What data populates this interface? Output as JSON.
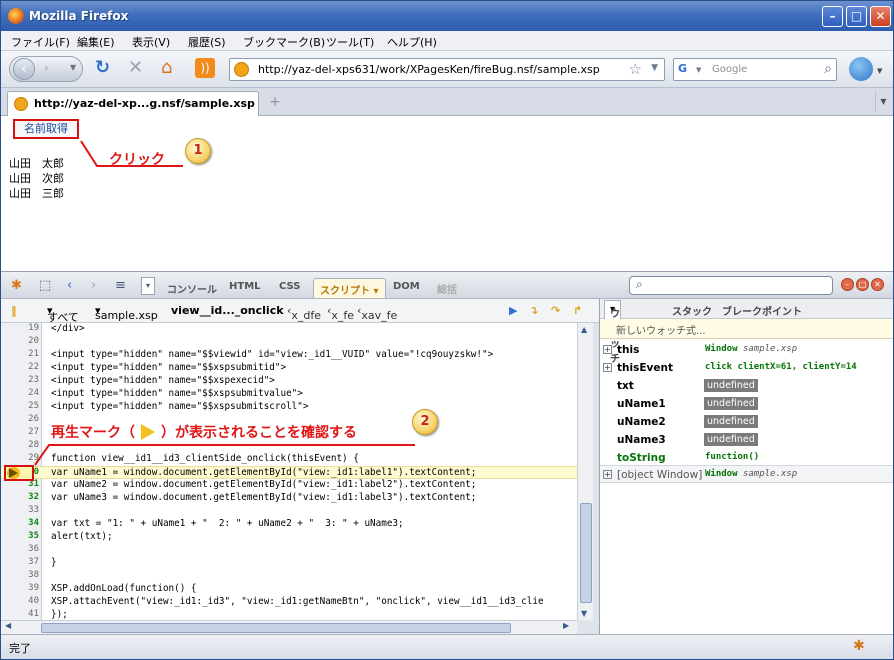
{
  "window": {
    "title": "Mozilla Firefox"
  },
  "menu": [
    "ファイル(F)",
    "編集(E)",
    "表示(V)",
    "履歴(S)",
    "ブックマーク(B)",
    "ツール(T)",
    "ヘルプ(H)"
  ],
  "nav": {
    "url": "http://yaz-del-xps631/work/XPagesKen/fireBug.nsf/sample.xsp",
    "search_placeholder": "Google"
  },
  "tab": {
    "label": "http://yaz-del-xp...g.nsf/sample.xsp"
  },
  "page": {
    "button_label": "名前取得",
    "names": [
      "山田　太郎",
      "山田　次郎",
      "山田　三郎"
    ]
  },
  "annotations": {
    "click_label": "クリック",
    "step1": "1",
    "step2": "2",
    "confirm_label_a": "再生マーク（",
    "confirm_label_b": "）が表示されることを確認する"
  },
  "firebug": {
    "tabs": [
      "コンソール",
      "HTML",
      "CSS",
      "スクリプト",
      "DOM",
      "総括"
    ],
    "active_tab": "スクリプト",
    "script_toolbar": {
      "filter": "すべて",
      "file": "sample.xsp",
      "stack": [
        "view__id..._onclick",
        "x_dfe",
        "x_fe",
        "xav_fe"
      ]
    },
    "code_lines": [
      {
        "n": "19",
        "code": "</div>",
        "exec": false
      },
      {
        "n": "20",
        "code": "",
        "exec": false
      },
      {
        "n": "21",
        "code": "<input type=\"hidden\" name=\"$$viewid\" id=\"view:_id1__VUID\" value=\"!cq9ouyzskw!\">",
        "exec": false
      },
      {
        "n": "22",
        "code": "<input type=\"hidden\" name=\"$$xspsubmitid\">",
        "exec": false
      },
      {
        "n": "23",
        "code": "<input type=\"hidden\" name=\"$$xspexecid\">",
        "exec": false
      },
      {
        "n": "24",
        "code": "<input type=\"hidden\" name=\"$$xspsubmitvalue\">",
        "exec": false
      },
      {
        "n": "25",
        "code": "<input type=\"hidden\" name=\"$$xspsubmitscroll\">",
        "exec": false
      },
      {
        "n": "26",
        "code": "",
        "exec": false
      },
      {
        "n": "27",
        "code": "",
        "exec": false
      },
      {
        "n": "28",
        "code": "",
        "exec": false
      },
      {
        "n": "29",
        "code": "function view__id1__id3_clientSide_onclick(thisEvent) {",
        "exec": false
      },
      {
        "n": "30",
        "code": "var uName1 = window.document.getElementById(\"view:_id1:label1\").textContent;",
        "exec": true
      },
      {
        "n": "31",
        "code": "var uName2 = window.document.getElementById(\"view:_id1:label2\").textContent;",
        "exec": true
      },
      {
        "n": "32",
        "code": "var uName3 = window.document.getElementById(\"view:_id1:label3\").textContent;",
        "exec": true
      },
      {
        "n": "33",
        "code": "",
        "exec": false
      },
      {
        "n": "34",
        "code": "var txt = \"1: \" + uName1 + \"  2: \" + uName2 + \"  3: \" + uName3;",
        "exec": true
      },
      {
        "n": "35",
        "code": "alert(txt);",
        "exec": true
      },
      {
        "n": "36",
        "code": "",
        "exec": false
      },
      {
        "n": "37",
        "code": "}",
        "exec": false
      },
      {
        "n": "38",
        "code": "",
        "exec": false
      },
      {
        "n": "39",
        "code": "XSP.addOnLoad(function() {",
        "exec": false
      },
      {
        "n": "40",
        "code": "XSP.attachEvent(\"view:_id1:_id3\", \"view:_id1:getNameBtn\", \"onclick\", view__id1__id3_clie",
        "exec": false
      },
      {
        "n": "41",
        "code": "});",
        "exec": false
      }
    ],
    "watch_tabs": [
      "ウォッチ",
      "スタック",
      "ブレークポイント"
    ],
    "new_watch": "新しいウォッチ式...",
    "watch_rows": [
      {
        "name": "this",
        "value": "Window",
        "extra": "sample.xsp",
        "type": "obj",
        "expand": true
      },
      {
        "name": "thisEvent",
        "value": "click clientX=61, clientY=14",
        "extra": "",
        "type": "obj",
        "expand": true
      },
      {
        "name": "txt",
        "value": "undefined",
        "extra": "",
        "type": "undef",
        "expand": false
      },
      {
        "name": "uName1",
        "value": "undefined",
        "extra": "",
        "type": "undef",
        "expand": false
      },
      {
        "name": "uName2",
        "value": "undefined",
        "extra": "",
        "type": "undef",
        "expand": false
      },
      {
        "name": "uName3",
        "value": "undefined",
        "extra": "",
        "type": "undef",
        "expand": false
      },
      {
        "name": "toString",
        "value": "function()",
        "extra": "",
        "type": "fn",
        "expand": false
      }
    ],
    "scope_row": {
      "name": "[object Window]",
      "value": "Window",
      "extra": "sample.xsp"
    }
  },
  "status": {
    "text": "完了"
  },
  "colors": {
    "annotation_red": "#e01515",
    "exec_green": "#118811",
    "highlight": "#fffbd0"
  }
}
